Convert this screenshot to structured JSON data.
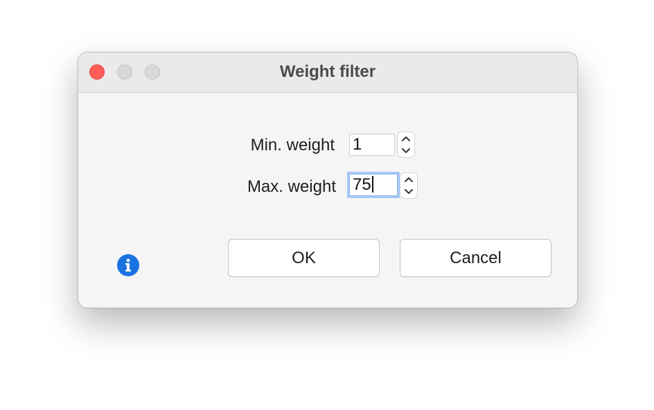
{
  "window": {
    "title": "Weight filter"
  },
  "form": {
    "min_label": "Min. weight",
    "min_value": "1",
    "max_label": "Max. weight",
    "max_value": "75"
  },
  "buttons": {
    "ok_label": "OK",
    "cancel_label": "Cancel"
  },
  "icons": {
    "info": "info-icon",
    "stepper_up": "chevron-up-icon",
    "stepper_down": "chevron-down-icon"
  },
  "colors": {
    "close": "#fe5f57",
    "focus_ring": "#a9c7f5",
    "info_blue": "#1a73e0"
  }
}
